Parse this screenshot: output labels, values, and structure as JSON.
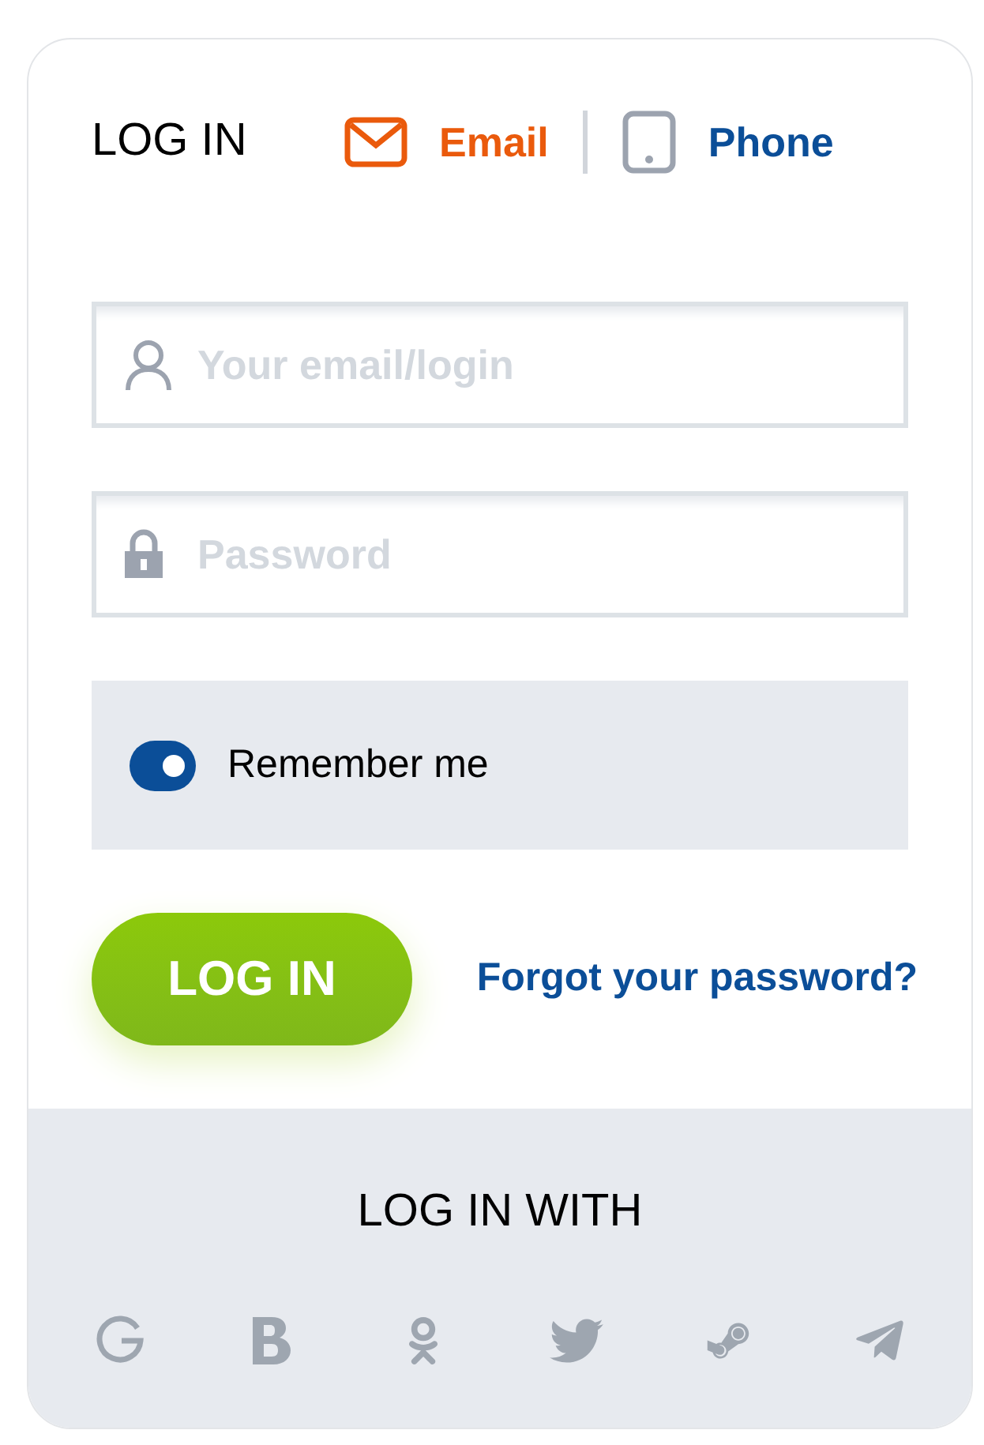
{
  "title": "LOG IN",
  "tabs": [
    {
      "kind": "email",
      "label": "Email",
      "selected": true
    },
    {
      "kind": "phone",
      "label": "Phone",
      "selected": false
    }
  ],
  "fields": [
    {
      "kind": "login",
      "placeholder": "Your email/login"
    },
    {
      "kind": "password",
      "placeholder": "Password"
    }
  ],
  "remember": {
    "label": "Remember me",
    "checked": true
  },
  "login_button": "LOG IN",
  "forgot_link": "Forgot your password?",
  "social": {
    "title": "LOG IN WITH",
    "providers": [
      {
        "kind": "g"
      },
      {
        "kind": "b"
      },
      {
        "kind": "ok"
      },
      {
        "kind": "bird"
      },
      {
        "kind": "steam"
      },
      {
        "kind": "plane"
      }
    ]
  }
}
